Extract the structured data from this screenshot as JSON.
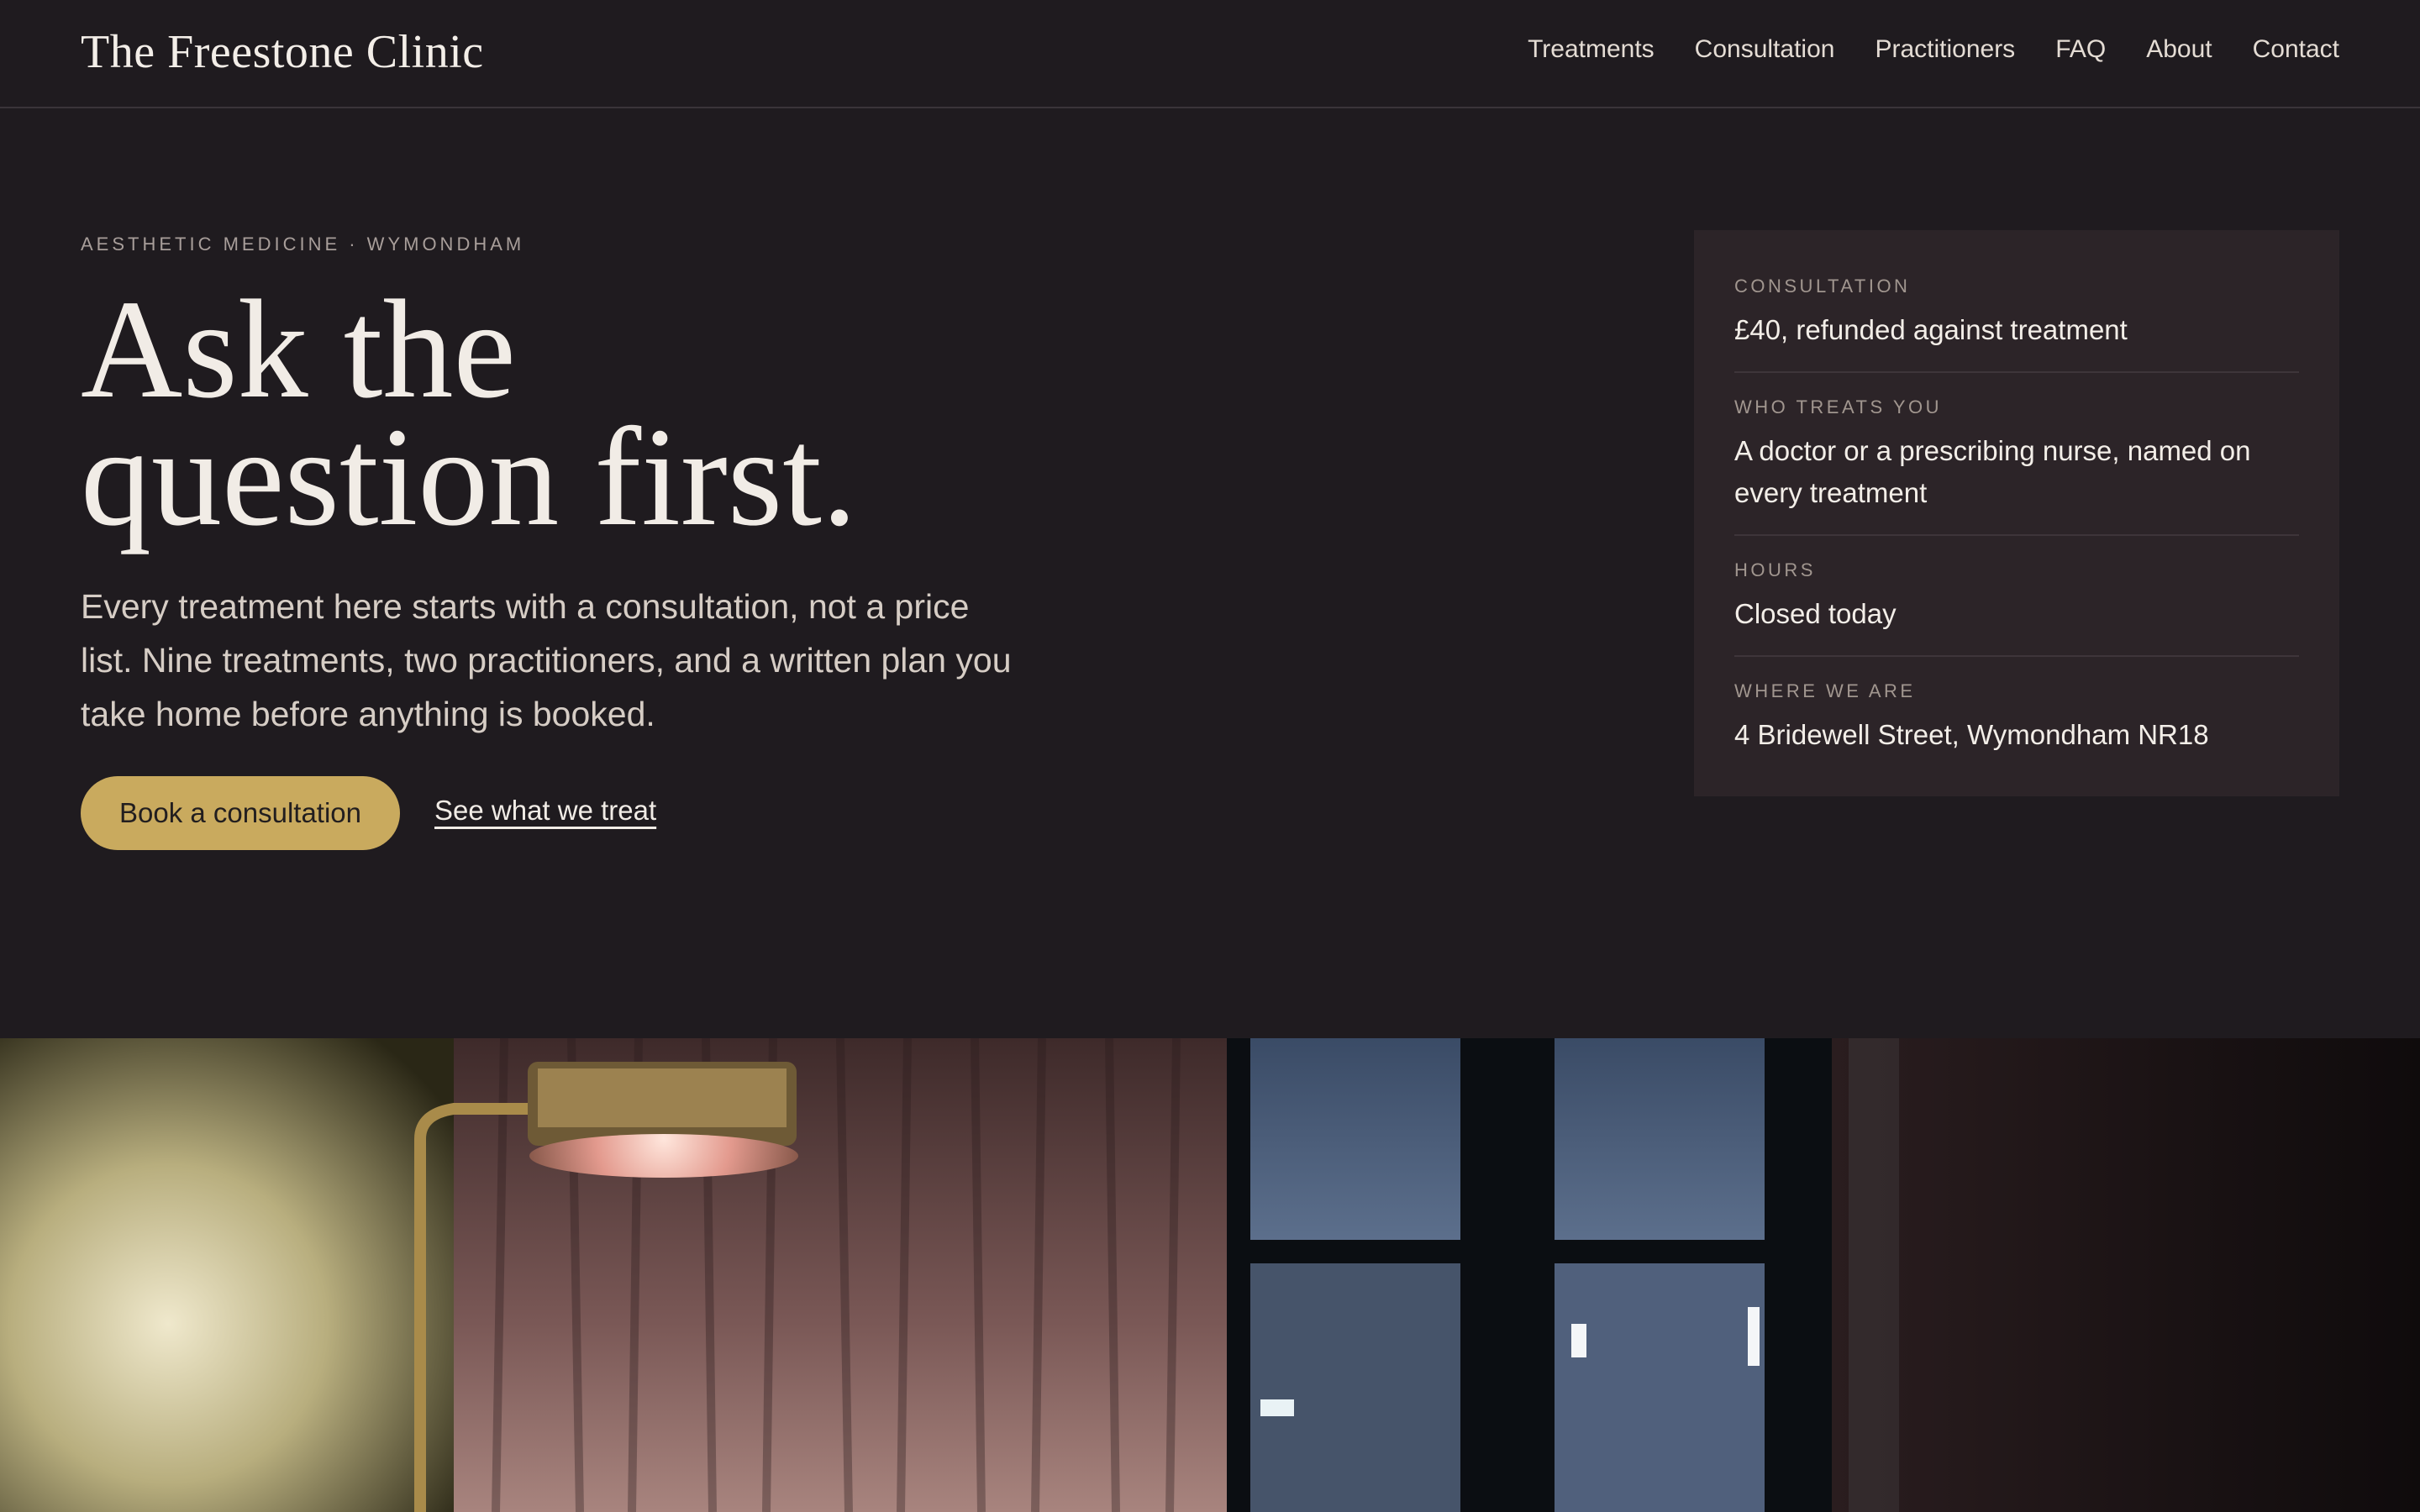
{
  "brand": {
    "name": "The Freestone Clinic"
  },
  "nav": {
    "items": [
      {
        "label": "Treatments"
      },
      {
        "label": "Consultation"
      },
      {
        "label": "Practitioners"
      },
      {
        "label": "FAQ"
      },
      {
        "label": "About"
      },
      {
        "label": "Contact"
      }
    ]
  },
  "hero": {
    "eyebrow": "AESTHETIC MEDICINE · WYMONDHAM",
    "headline_line1": "Ask the",
    "headline_line2": "question first.",
    "lede": "Every treatment here starts with a consultation, not a price list. Nine treatments, two practitioners, and a written plan you take home before anything is booked.",
    "cta_primary": "Book a consultation",
    "cta_secondary": "See what we treat"
  },
  "info_card": {
    "rows": [
      {
        "label": "CONSULTATION",
        "value": "£40, refunded against treatment"
      },
      {
        "label": "WHO TREATS YOU",
        "value": "A doctor or a prescribing nurse, named on every treatment"
      },
      {
        "label": "HOURS",
        "value": "Closed today"
      },
      {
        "label": "WHERE WE ARE",
        "value": "4 Bridewell Street, Wymondham NR18"
      }
    ]
  },
  "colors": {
    "background": "#1f1b1f",
    "card": "#2c2428",
    "accent_gold": "#c9aa5e",
    "text": "#f1ece6"
  },
  "photo": {
    "icon": "interior-photo"
  }
}
